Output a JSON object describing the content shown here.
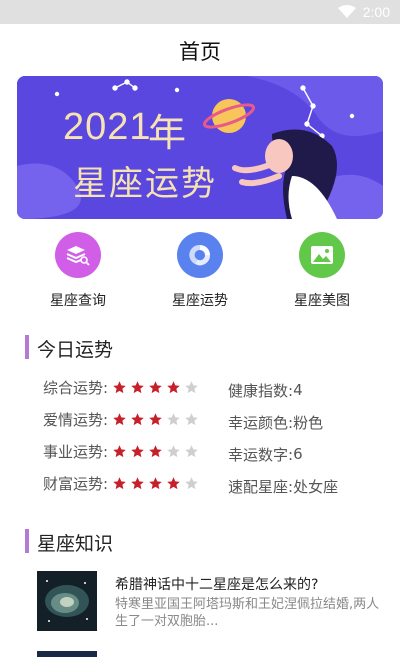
{
  "status_bar": {
    "time": "2:00",
    "icons": [
      "wifi-icon",
      "battery-icon"
    ]
  },
  "header": {
    "title": "首页"
  },
  "banner": {
    "year": "2021",
    "year_suffix": "年",
    "subtitle": "星座运势",
    "background_color": "#5a47e0",
    "text_color": "#f6e3b1"
  },
  "quick_links": [
    {
      "label": "星座查询",
      "icon": "layers-search-icon",
      "color": "#d05ee6"
    },
    {
      "label": "星座运势",
      "icon": "swirl-icon",
      "color": "#5a82ef"
    },
    {
      "label": "星座美图",
      "icon": "image-icon",
      "color": "#62c84a"
    }
  ],
  "today": {
    "section_title": "今日运势",
    "accent_color": "#b57ad8",
    "star_color": "#c8202a",
    "ratings": [
      {
        "label": "综合运势:",
        "stars": 4,
        "max": 5
      },
      {
        "label": "爱情运势:",
        "stars": 3,
        "max": 5
      },
      {
        "label": "事业运势:",
        "stars": 3,
        "max": 5
      },
      {
        "label": "财富运势:",
        "stars": 4,
        "max": 5
      }
    ],
    "info": [
      {
        "label": "健康指数:",
        "value": "4"
      },
      {
        "label": "幸运颜色:",
        "value": "粉色"
      },
      {
        "label": "幸运数字:",
        "value": "6"
      },
      {
        "label": "速配星座:",
        "value": "处女座"
      }
    ]
  },
  "knowledge": {
    "section_title": "星座知识",
    "articles": [
      {
        "title": "希腊神话中十二星座是怎么来的?",
        "desc": "特寒里亚国王阿塔玛斯和王妃涅佩拉结婚,两人生了一对双胞胎..."
      }
    ]
  }
}
